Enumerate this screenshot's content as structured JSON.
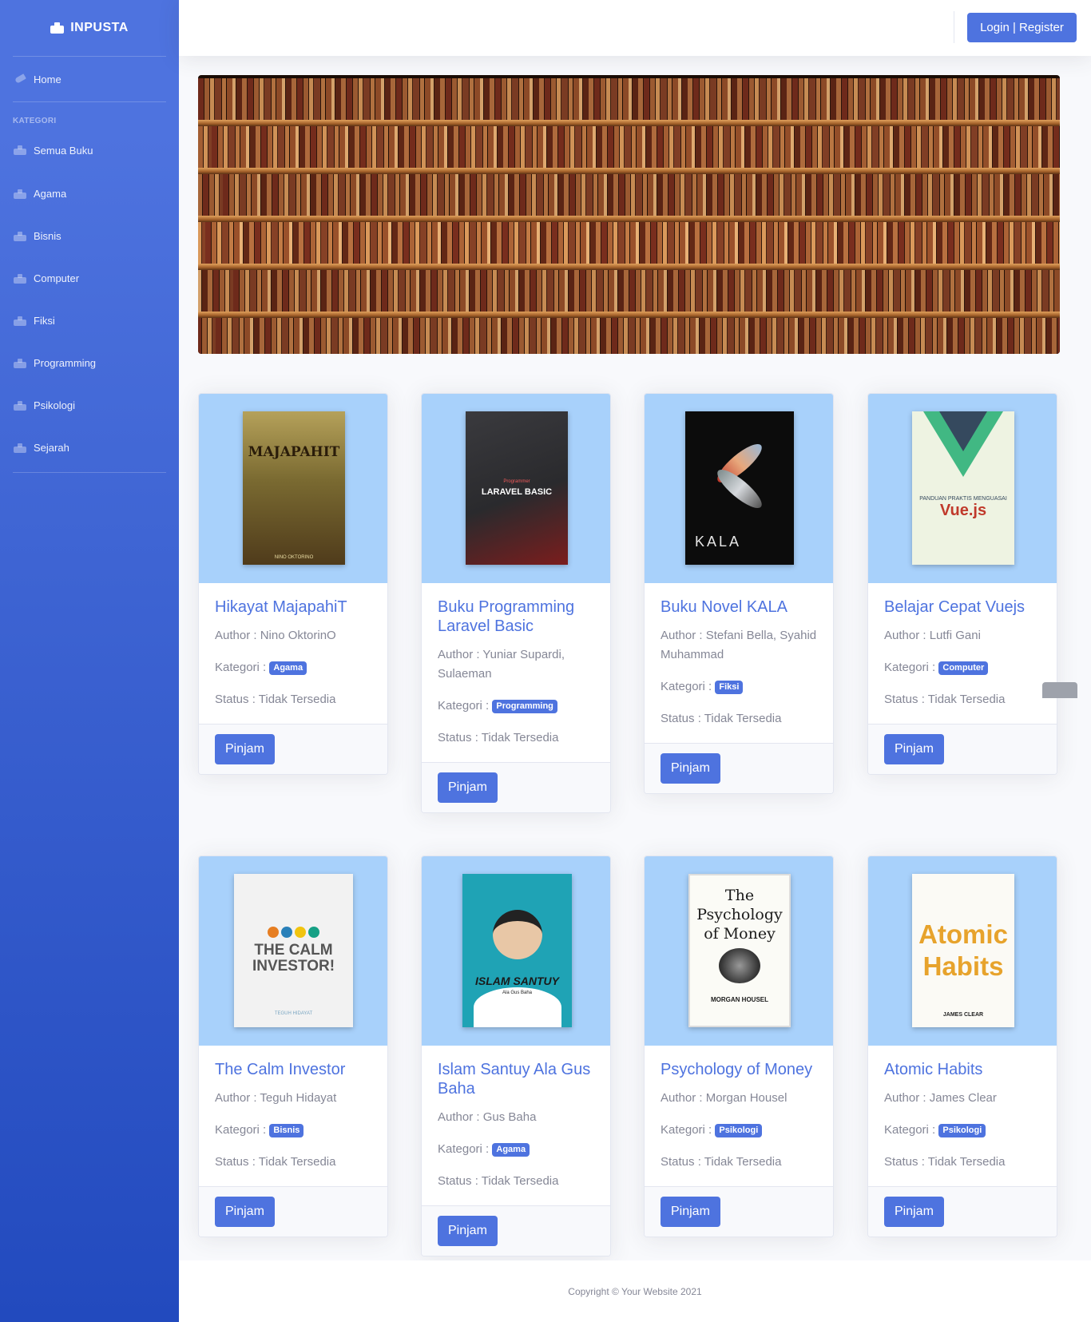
{
  "brand": {
    "name": "INPUSTA",
    "icon": "box-logo-icon"
  },
  "sidebar": {
    "home": {
      "label": "Home",
      "icon": "rocket-icon"
    },
    "heading": "KATEGORI",
    "items": [
      {
        "label": "Semua Buku"
      },
      {
        "label": "Agama"
      },
      {
        "label": "Bisnis"
      },
      {
        "label": "Computer"
      },
      {
        "label": "Fiksi"
      },
      {
        "label": "Programming"
      },
      {
        "label": "Psikologi"
      },
      {
        "label": "Sejarah"
      }
    ]
  },
  "topbar": {
    "login_label": "Login | Register"
  },
  "books": [
    {
      "title": "Hikayat MajapahiT",
      "author": "Author : Nino OktorinO",
      "kategori_label": "Kategori :",
      "kategori": "Agama",
      "status": "Status : Tidak Tersedia",
      "button": "Pinjam",
      "cover_text": "MAJAPAHIT",
      "cover_sub": "NINO OKTORINO",
      "cover_bg": "#6b5a2a"
    },
    {
      "title": "Buku Programming Laravel Basic",
      "author": "Author : Yuniar Supardi, Sulaeman",
      "kategori_label": "Kategori :",
      "kategori": "Programming",
      "status": "Status : Tidak Tersedia",
      "button": "Pinjam",
      "cover_text": "LARAVEL BASIC",
      "cover_sub": "Programmer",
      "cover_bg": "#2b2b2e"
    },
    {
      "title": "Buku Novel KALA",
      "author": "Author : Stefani Bella, Syahid Muhammad",
      "kategori_label": "Kategori :",
      "kategori": "Fiksi",
      "status": "Status : Tidak Tersedia",
      "button": "Pinjam",
      "cover_text": "KALA",
      "cover_sub": "",
      "cover_bg": "#0c0c0c"
    },
    {
      "title": "Belajar Cepat Vuejs",
      "author": "Author : Lutfi Gani",
      "kategori_label": "Kategori :",
      "kategori": "Computer",
      "status": "Status : Tidak Tersedia",
      "button": "Pinjam",
      "cover_text": "Vue.js",
      "cover_sub": "PANDUAN PRAKTIS MENGUASAI",
      "cover_bg": "#eef3e2"
    },
    {
      "title": "The Calm Investor",
      "author": "Author : Teguh Hidayat",
      "kategori_label": "Kategori :",
      "kategori": "Bisnis",
      "status": "Status : Tidak Tersedia",
      "button": "Pinjam",
      "cover_text": "THE CALM INVESTOR!",
      "cover_sub": "TEGUH HIDAYAT",
      "cover_bg": "#f2f2f2"
    },
    {
      "title": "Islam Santuy Ala Gus Baha",
      "author": "Author : Gus Baha",
      "kategori_label": "Kategori :",
      "kategori": "Agama",
      "status": "Status : Tidak Tersedia",
      "button": "Pinjam",
      "cover_text": "ISLAM SANTUY",
      "cover_sub": "Ala Gus Baha",
      "cover_bg": "#1fa3b5"
    },
    {
      "title": "Psychology of Money",
      "author": "Author : Morgan Housel",
      "kategori_label": "Kategori :",
      "kategori": "Psikologi",
      "status": "Status : Tidak Tersedia",
      "button": "Pinjam",
      "cover_text": "The Psychology of Money",
      "cover_sub": "MORGAN HOUSEL",
      "cover_bg": "#fbfbf6"
    },
    {
      "title": "Atomic Habits",
      "author": "Author : James Clear",
      "kategori_label": "Kategori :",
      "kategori": "Psikologi",
      "status": "Status : Tidak Tersedia",
      "button": "Pinjam",
      "cover_text": "Atomic Habits",
      "cover_sub": "JAMES CLEAR",
      "cover_bg": "#fbfaf5"
    }
  ],
  "footer": {
    "copyright": "Copyright © Your Website 2021"
  },
  "colors": {
    "primary": "#4e73df",
    "sidebar_bottom": "#224abe",
    "card_image_bg": "#a8d1fb"
  }
}
